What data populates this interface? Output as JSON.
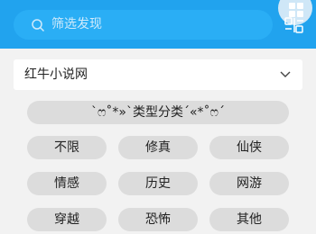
{
  "search": {
    "placeholder": "筛选发现"
  },
  "source_dropdown": {
    "selected": "红牛小说网"
  },
  "section": {
    "title": "`ෆ˚*»`类型分类´«*˚ෆ´"
  },
  "tags": [
    "不限",
    "修真",
    "仙侠",
    "情感",
    "历史",
    "网游",
    "穿越",
    "恐怖",
    "其他"
  ],
  "icons": {
    "search": "search-icon",
    "grid": "grid-icon",
    "filter": "filter-icon",
    "dropdown": "chevron-down-icon"
  },
  "colors": {
    "topbar": "#21a3ee",
    "search_bg": "#2aaef5",
    "chip_bg": "#dcdcdc",
    "page_bg": "#f2f2f2"
  }
}
